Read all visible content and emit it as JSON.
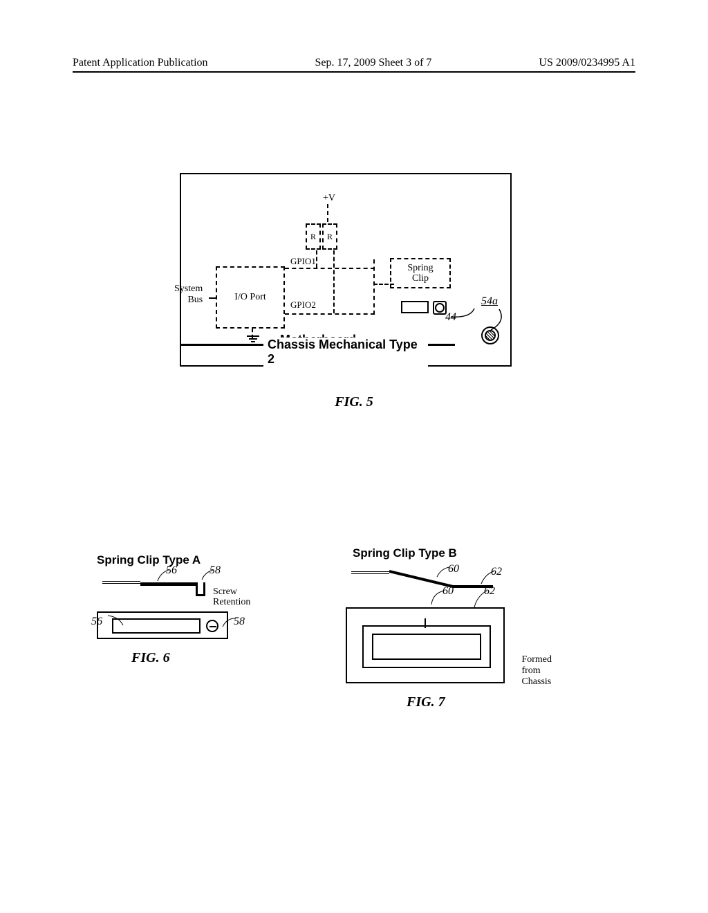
{
  "header": {
    "left": "Patent Application Publication",
    "center": "Sep. 17, 2009  Sheet 3 of 7",
    "right": "US 2009/0234995 A1"
  },
  "fig5": {
    "plus_v": "+V",
    "r": "R",
    "system_bus": "System\nBus",
    "io_port": "I/O Port",
    "gpio1": "GPIO1",
    "gpio2": "GPIO2",
    "spring_clip": "Spring\nClip",
    "motherboard": "Motherboard",
    "chassis": "Chassis Mechanical Type 2",
    "ref44": "44",
    "ref54a": "54a",
    "caption": "FIG. 5"
  },
  "fig6": {
    "title": "Spring Clip Type A",
    "ref56": "56",
    "ref58": "58",
    "screw_retention": "Screw\nRetention",
    "caption": "FIG. 6"
  },
  "fig7": {
    "title": "Spring Clip Type B",
    "ref60": "60",
    "ref62": "62",
    "formed": "Formed\nfrom\nChassis",
    "caption": "FIG. 7"
  }
}
